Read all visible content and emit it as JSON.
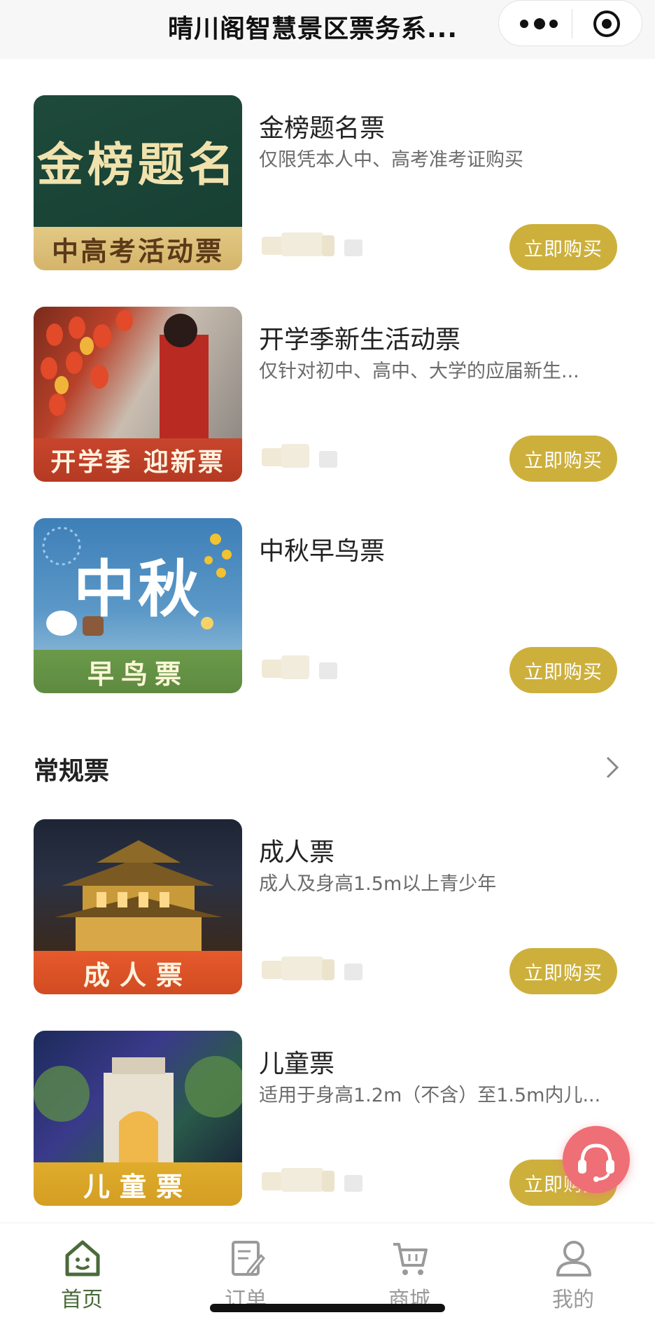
{
  "header": {
    "title": "晴川阁智慧景区票务系..."
  },
  "featured": [
    {
      "name": "金榜题名票",
      "desc": "仅限凭本人中、高考准考证购买",
      "thumb_title": "金榜题名",
      "thumb_band": "中高考活动票",
      "buy_label": "立即购买"
    },
    {
      "name": "开学季新生活动票",
      "desc": "仅针对初中、高中、大学的应届新生...",
      "thumb_band": "开学季 迎新票",
      "buy_label": "立即购买"
    },
    {
      "name": "中秋早鸟票",
      "desc": "",
      "thumb_title": "中秋",
      "thumb_band": "早鸟票",
      "buy_label": "立即购买"
    }
  ],
  "regular": {
    "section_title": "常规票",
    "items": [
      {
        "name": "成人票",
        "desc": "成人及身高1.5m以上青少年",
        "thumb_band": "成人票",
        "buy_label": "立即购买"
      },
      {
        "name": "儿童票",
        "desc": "适用于身高1.2m（不含）至1.5m内儿...",
        "thumb_band": "儿童票",
        "buy_label": "立即购买"
      }
    ]
  },
  "tabbar": [
    {
      "label": "首页",
      "icon": "home-icon",
      "active": true
    },
    {
      "label": "订单",
      "icon": "order-icon",
      "active": false
    },
    {
      "label": "商城",
      "icon": "cart-icon",
      "active": false
    },
    {
      "label": "我的",
      "icon": "user-icon",
      "active": false
    }
  ],
  "colors": {
    "accent": "#cdb03c",
    "tab_active": "#4a6b3a",
    "tab_inactive": "#9a9a9a",
    "service": "#ee6f75"
  }
}
